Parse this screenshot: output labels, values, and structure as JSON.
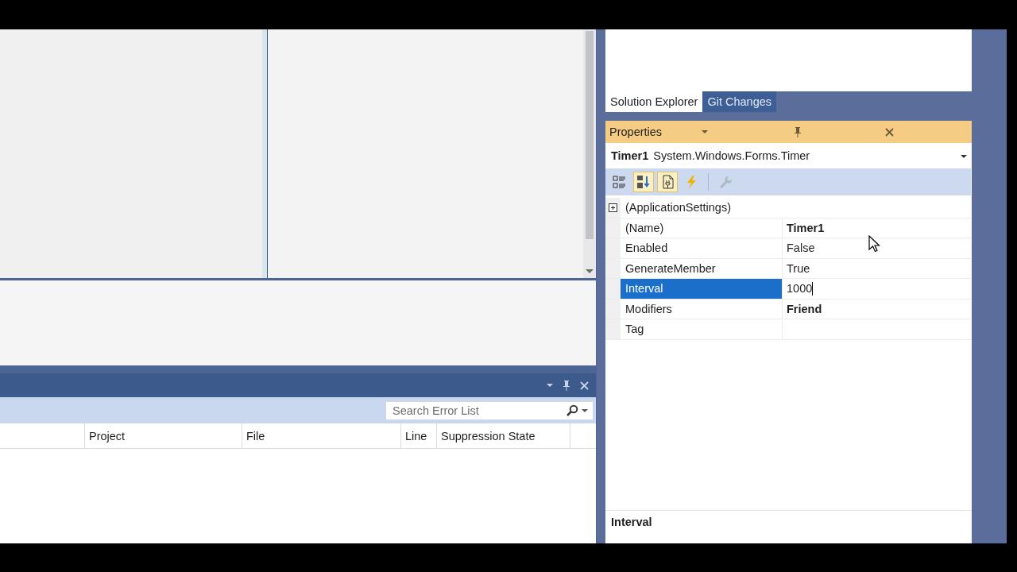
{
  "error_list": {
    "search": {
      "placeholder": "Search Error List"
    },
    "columns": [
      "Project",
      "File",
      "Line",
      "Suppression State"
    ]
  },
  "tabs": [
    {
      "label": "Solution Explorer",
      "selected": true
    },
    {
      "label": "Git Changes",
      "selected": false
    }
  ],
  "properties": {
    "title": "Properties",
    "object": {
      "name": "Timer1",
      "type": "System.Windows.Forms.Timer"
    },
    "toolbar": [
      {
        "kind": "categorized",
        "selected": false,
        "disabled": false
      },
      {
        "kind": "alphabetical",
        "selected": true,
        "disabled": false
      },
      {
        "kind": "property-pages",
        "selected": true,
        "disabled": false
      },
      {
        "kind": "events",
        "selected": false,
        "disabled": false
      },
      {
        "kind": "wrench",
        "selected": false,
        "disabled": true
      }
    ],
    "rows": [
      {
        "kind": "group",
        "name": "(ApplicationSettings)",
        "expanded": false,
        "selected": false
      },
      {
        "kind": "property",
        "name": "(Name)",
        "value": "Timer1",
        "modified": true,
        "selected": false,
        "editing": false
      },
      {
        "kind": "property",
        "name": "Enabled",
        "value": "False",
        "modified": false,
        "selected": false,
        "editing": false
      },
      {
        "kind": "property",
        "name": "GenerateMember",
        "value": "True",
        "modified": false,
        "selected": false,
        "editing": false
      },
      {
        "kind": "property",
        "name": "Interval",
        "value": "1000",
        "modified": false,
        "selected": true,
        "editing": true
      },
      {
        "kind": "property",
        "name": "Modifiers",
        "value": "Friend",
        "modified": true,
        "selected": false,
        "editing": false
      },
      {
        "kind": "property",
        "name": "Tag",
        "selected": false
      }
    ],
    "description": {
      "title": "Interval"
    }
  }
}
